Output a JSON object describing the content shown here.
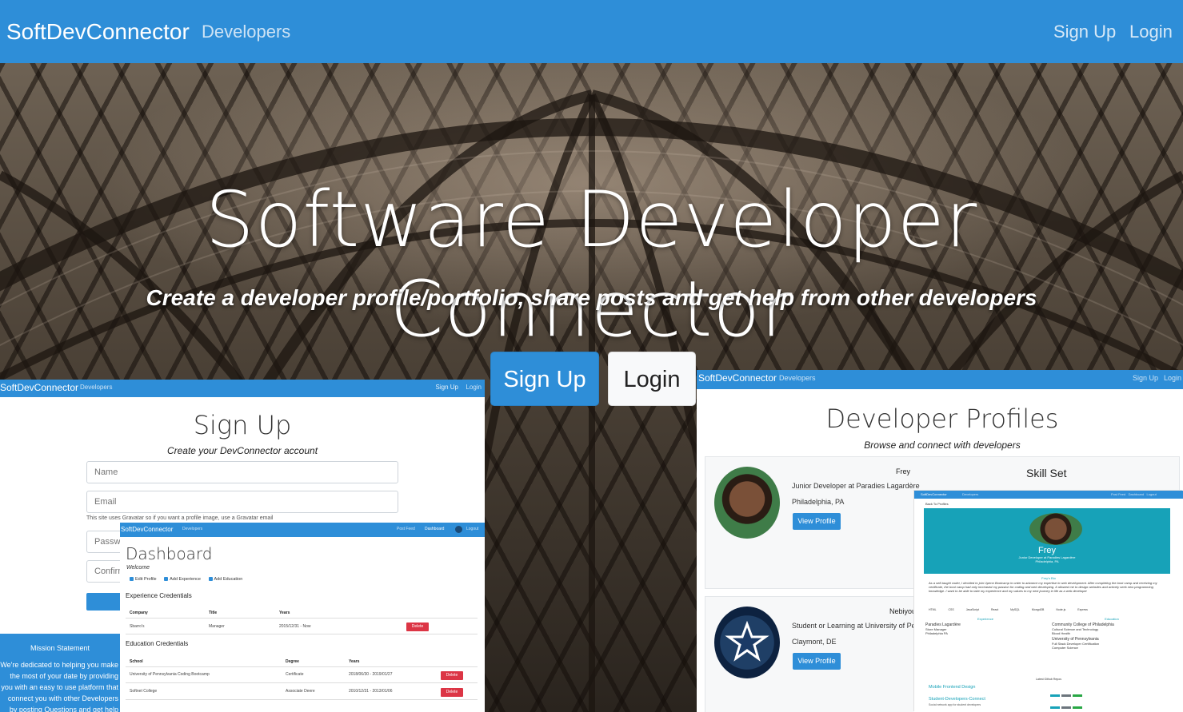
{
  "nav": {
    "brand": "SoftDevConnector",
    "developers": "Developers",
    "signup": "Sign Up",
    "login": "Login"
  },
  "hero": {
    "title": "Software Developer Connector",
    "subtitle": "Create a developer profile/portfolio, share posts and get help from other developers",
    "signup_btn": "Sign Up",
    "login_btn": "Login"
  },
  "signup_page": {
    "nav": {
      "brand": "SoftDevConnector",
      "developers": "Developers",
      "signup": "Sign Up",
      "login": "Login"
    },
    "title": "Sign Up",
    "subtitle": "Create your DevConnector account",
    "name_placeholder": "Name",
    "email_placeholder": "Email",
    "help": "This site uses Gravatar so if you want a profile image, use a Gravatar email",
    "password_placeholder": "Password",
    "confirm_placeholder": "Confirm Password"
  },
  "mission": {
    "title": "Mission Statement",
    "body": "We're dedicated to helping you make the most of your date by providing you with an easy to use platform that connect you with other Developers by posting Questions and get help from others."
  },
  "dashboard": {
    "nav": {
      "brand": "SoftDevConnector",
      "developers": "Developers",
      "post_feed": "Post Feed",
      "dashboard": "Dashboard",
      "logout": "Logout"
    },
    "title": "Dashboard",
    "welcome": "Welcome",
    "actions": [
      "Edit Profile",
      "Add Experience",
      "Add Education"
    ],
    "experience_title": "Experience Credentials",
    "experience_headers": [
      "Company",
      "Title",
      "Years"
    ],
    "experience_rows": [
      [
        "Sbarro's",
        "Manager",
        "2015/12/31 - Now"
      ]
    ],
    "education_title": "Education Credentials",
    "education_headers": [
      "School",
      "Degree",
      "Years"
    ],
    "education_rows": [
      [
        "University of Pennsylvania Coding Bootcamp",
        "Certificate",
        "2018/06/30 - 2019/01/27"
      ],
      [
        "Softnet College",
        "Associate Deere",
        "2010/12/31 - 2013/01/06"
      ]
    ],
    "delete_label": "Delete"
  },
  "profiles_page": {
    "nav": {
      "brand": "SoftDevConnector",
      "developers": "Developers",
      "signup": "Sign Up",
      "login": "Login"
    },
    "title": "Developer Profiles",
    "subtitle": "Browse and connect with developers",
    "skill_set": "Skill Set",
    "view_profile": "View Profile",
    "profiles": [
      {
        "name": "Frey",
        "role": "Junior Developer at Paradies Lagardère",
        "location": "Philadelphia, PA"
      },
      {
        "name": "Nebiyou",
        "role": "Student or Learning at University of Pennsylvania",
        "location": "Claymont, DE"
      }
    ]
  },
  "profile_detail": {
    "back": "Back To Profiles",
    "name": "Frey",
    "role": "Junior Developer at Paradies Lagardère",
    "location": "Philadelphia, PA",
    "bio_title": "Frey's Bio",
    "bio": "As a self-taught coder, I decided to join Upenn Bootcamp in order to advance my expertise in web development. After completing the boot camp and receiving my certificate, the boot camp had only increased my passion for coding and web developing. It allowed me to design websites and actively seek new programming knowledge. I want to be able to take my experience and my values to my next journey in life as a web developer",
    "skill_set_title": "Skill Set",
    "skills": [
      "HTML",
      "CSS",
      "JavaScript",
      "React",
      "MySQL",
      "MongoDB",
      "Node.js",
      "Express"
    ],
    "experience_title": "Experience",
    "experience": {
      "company": "Paradies Lagardère",
      "title": "Store Manager",
      "location": "Philadelphia PA"
    },
    "education_title": "Education",
    "education": [
      {
        "school": "Community College of Philadelphia",
        "degree": "Cultural Science and Technology",
        "field": "Blood Health"
      },
      {
        "school": "University of Pennsylvania",
        "degree": "Full Stack Developer Certification",
        "field": "Computer Science"
      }
    ],
    "repos_title": "Latest Github Repos",
    "repos": [
      {
        "name": "Mobile Frontend Design",
        "desc": ""
      },
      {
        "name": "Student-Developers-Connect",
        "desc": "Social network app for student developers"
      }
    ],
    "badge_colors": [
      "#17a2b8",
      "#6c757d",
      "#28a745"
    ]
  }
}
